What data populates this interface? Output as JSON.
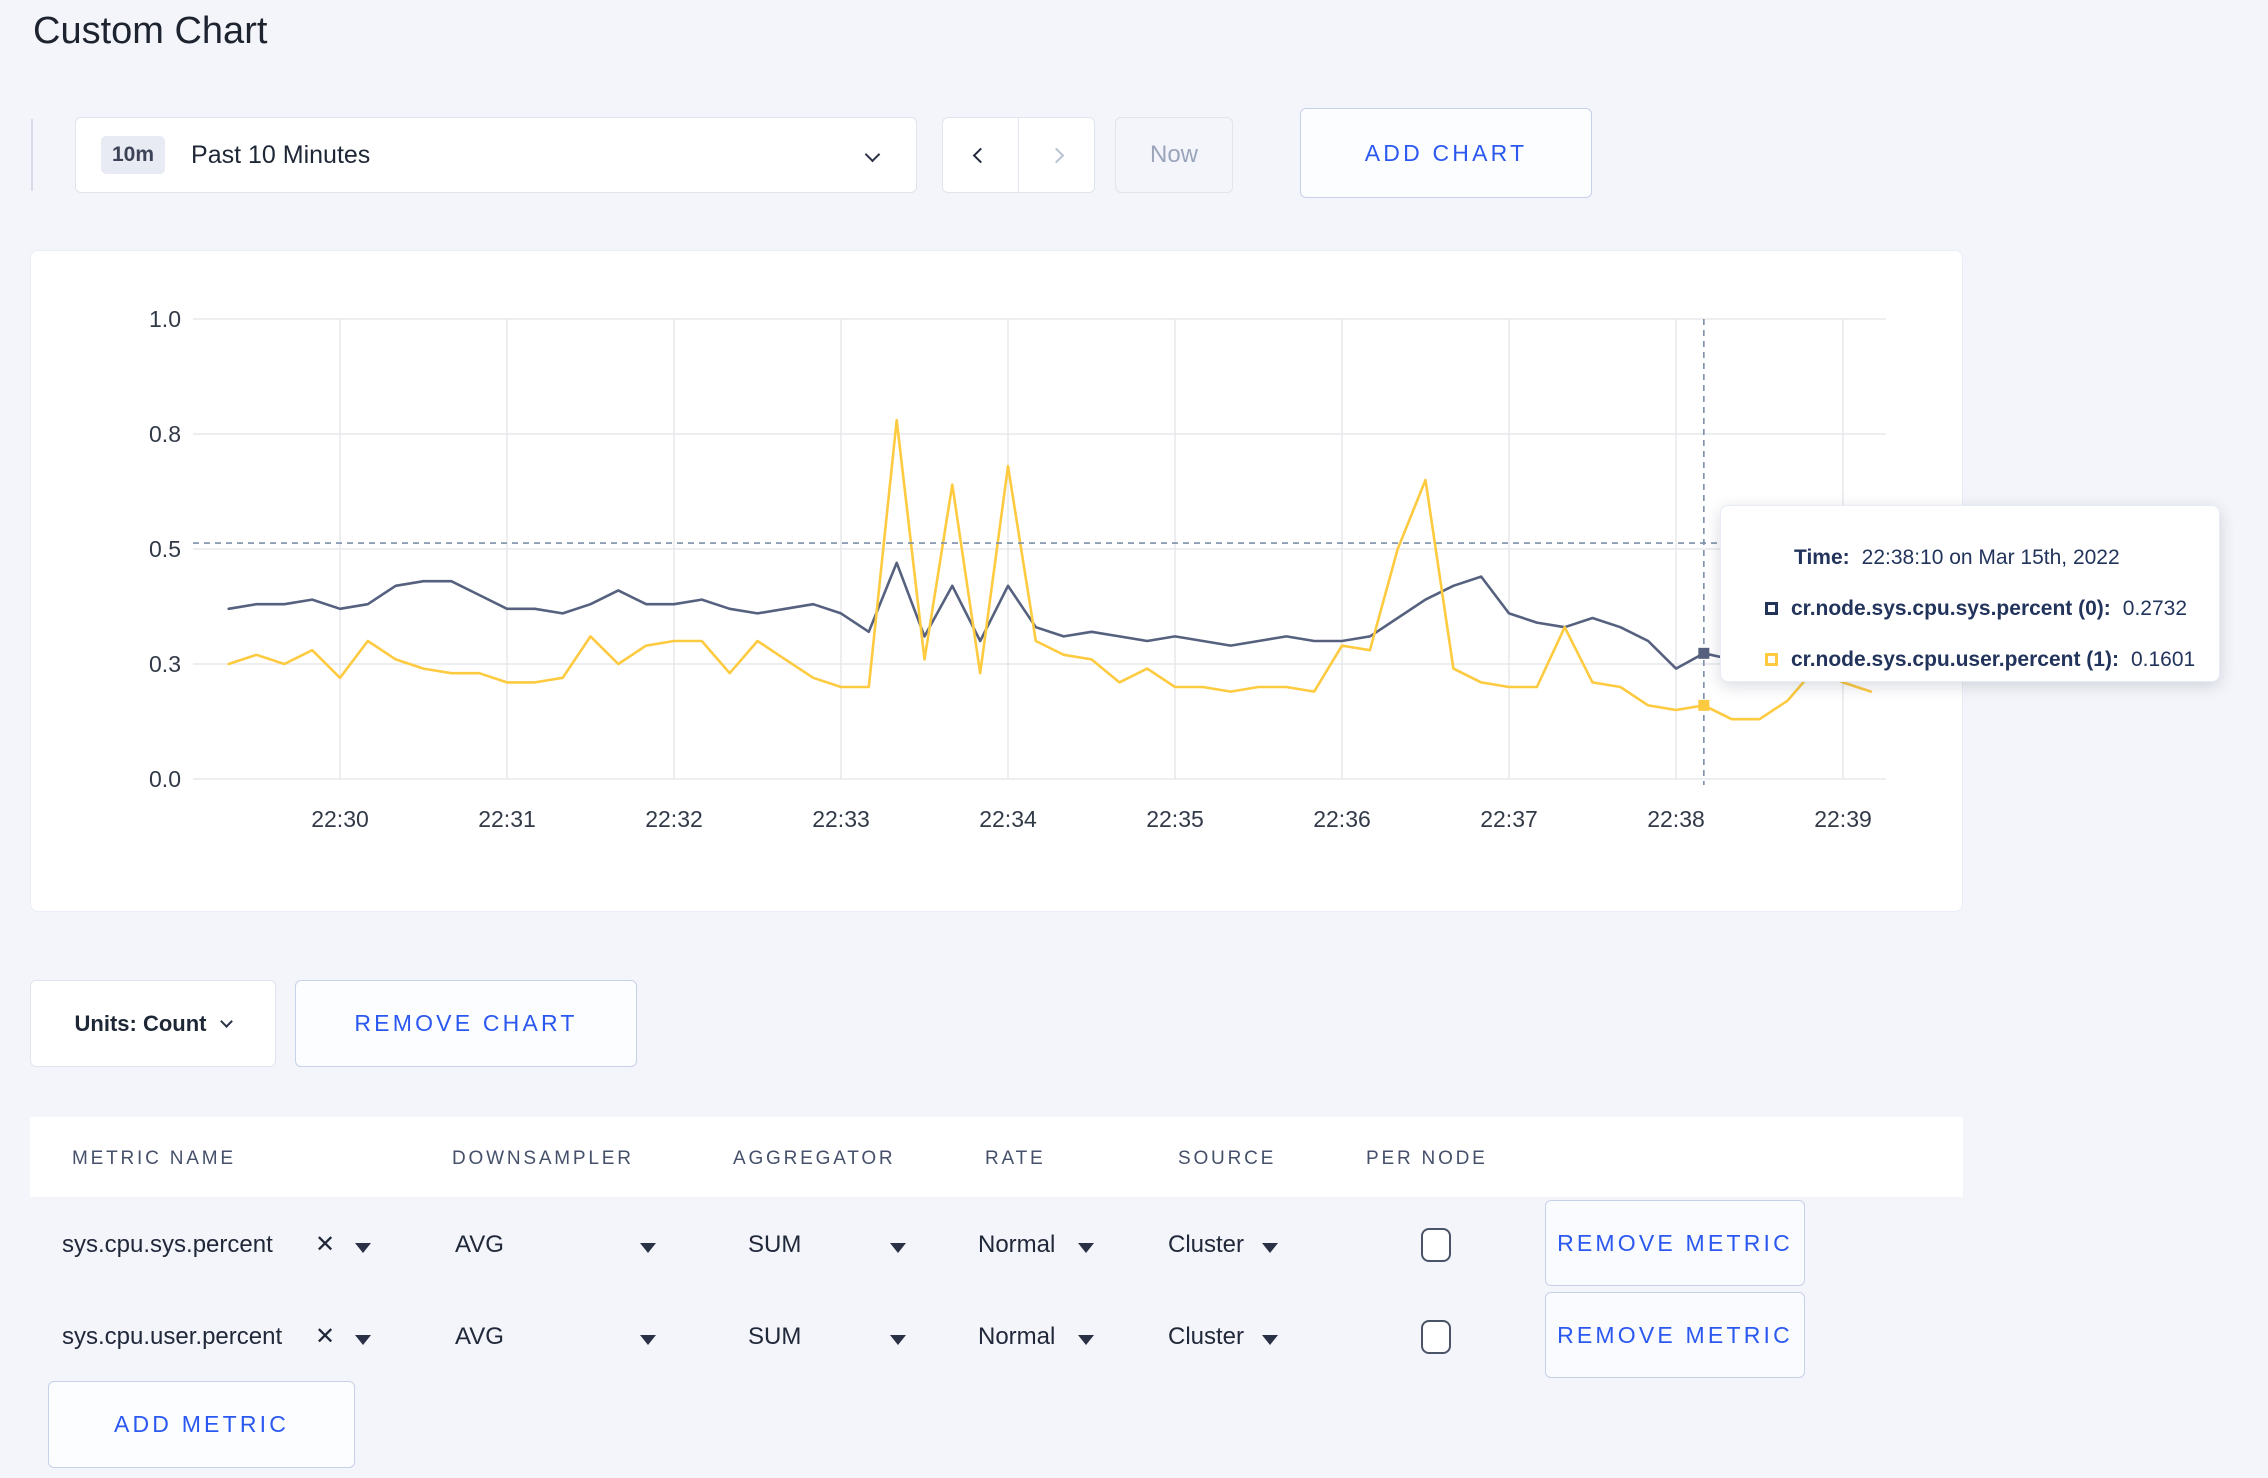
{
  "page": {
    "title": "Custom Chart"
  },
  "toolbar": {
    "range_badge": "10m",
    "range_label": "Past 10 Minutes",
    "now_label": "Now",
    "add_chart_label": "ADD CHART"
  },
  "chart_controls": {
    "units_label": "Units: Count",
    "remove_chart_label": "REMOVE CHART"
  },
  "chart_data": {
    "type": "line",
    "title": "",
    "xlabel": "",
    "ylabel": "",
    "grid": true,
    "legend_position": "none",
    "x_axis": {
      "ticks": [
        "22:30",
        "22:31",
        "22:32",
        "22:33",
        "22:34",
        "22:35",
        "22:36",
        "22:37",
        "22:38",
        "22:39"
      ],
      "start_offset_min": -0.66667,
      "step_min": 0.16667
    },
    "y_axis": {
      "range": [
        0,
        1
      ],
      "ticks": [
        {
          "value": 0,
          "label": "0.0"
        },
        {
          "value": 0.25,
          "label": "0.3"
        },
        {
          "value": 0.5,
          "label": "0.5"
        },
        {
          "value": 0.75,
          "label": "0.8"
        },
        {
          "value": 1,
          "label": "1.0"
        }
      ]
    },
    "series": [
      {
        "name": "cr.node.sys.cpu.sys.percent",
        "color": "#55617e",
        "values": [
          0.37,
          0.38,
          0.38,
          0.39,
          0.37,
          0.38,
          0.42,
          0.43,
          0.43,
          0.4,
          0.37,
          0.37,
          0.36,
          0.38,
          0.41,
          0.38,
          0.38,
          0.39,
          0.37,
          0.36,
          0.37,
          0.38,
          0.36,
          0.32,
          0.47,
          0.31,
          0.42,
          0.3,
          0.42,
          0.33,
          0.31,
          0.32,
          0.31,
          0.3,
          0.31,
          0.3,
          0.29,
          0.3,
          0.31,
          0.3,
          0.3,
          0.31,
          0.35,
          0.39,
          0.42,
          0.44,
          0.36,
          0.34,
          0.33,
          0.35,
          0.33,
          0.3,
          0.24,
          0.2732,
          0.26,
          0.28,
          0.3,
          0.31,
          0.3,
          0.3
        ]
      },
      {
        "name": "cr.node.sys.cpu.user.percent",
        "color": "#fdca40",
        "values": [
          0.25,
          0.27,
          0.25,
          0.28,
          0.22,
          0.3,
          0.26,
          0.24,
          0.23,
          0.23,
          0.21,
          0.21,
          0.22,
          0.31,
          0.25,
          0.29,
          0.3,
          0.3,
          0.23,
          0.3,
          0.26,
          0.22,
          0.2,
          0.2,
          0.78,
          0.26,
          0.64,
          0.23,
          0.68,
          0.3,
          0.27,
          0.26,
          0.21,
          0.24,
          0.2,
          0.2,
          0.19,
          0.2,
          0.2,
          0.19,
          0.29,
          0.28,
          0.5,
          0.65,
          0.24,
          0.21,
          0.2,
          0.2,
          0.33,
          0.21,
          0.2,
          0.16,
          0.15,
          0.1601,
          0.13,
          0.13,
          0.17,
          0.24,
          0.21,
          0.19
        ]
      }
    ],
    "crosshair": {
      "time_offset_min": 8.16667,
      "hover_index": 53,
      "hline_value": 0.513
    }
  },
  "tooltip": {
    "time_label": "Time:",
    "time_value": "22:38:10 on Mar 15th, 2022",
    "series": [
      {
        "swatch_color": "#223457",
        "name": "cr.node.sys.cpu.sys.percent (0):",
        "value": "0.2732"
      },
      {
        "swatch_color": "#fdca40",
        "name": "cr.node.sys.cpu.user.percent (1):",
        "value": "0.1601"
      }
    ]
  },
  "metrics_table": {
    "headers": [
      "METRIC NAME",
      "DOWNSAMPLER",
      "AGGREGATOR",
      "RATE",
      "SOURCE",
      "PER NODE"
    ],
    "rows": [
      {
        "metric": "sys.cpu.sys.percent",
        "downsampler": "AVG",
        "aggregator": "SUM",
        "rate": "Normal",
        "source": "Cluster",
        "per_node_checked": false,
        "remove_label": "REMOVE METRIC"
      },
      {
        "metric": "sys.cpu.user.percent",
        "downsampler": "AVG",
        "aggregator": "SUM",
        "rate": "Normal",
        "source": "Cluster",
        "per_node_checked": false,
        "remove_label": "REMOVE METRIC"
      }
    ],
    "add_metric_label": "ADD METRIC"
  },
  "colors": {
    "accent_blue": "#2b59f0",
    "series_sys": "#55617e",
    "series_user": "#fdca40",
    "page_background": "#f4f5fa",
    "gridline": "#e7e8ec",
    "crosshair": "#7d90aa"
  }
}
